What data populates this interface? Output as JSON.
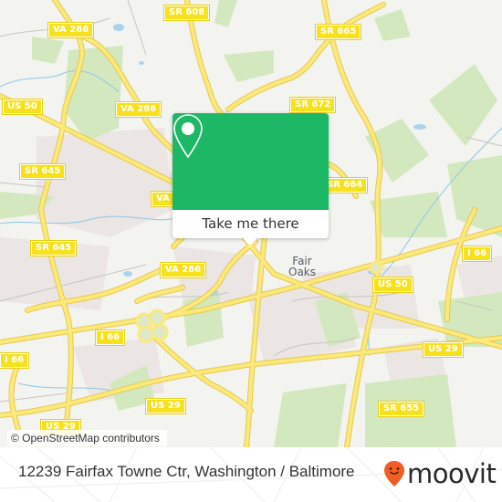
{
  "map": {
    "road_labels": [
      {
        "id": "va286-nw",
        "text": "VA 286"
      },
      {
        "id": "sr608",
        "text": "SR 608"
      },
      {
        "id": "sr665",
        "text": "SR 665"
      },
      {
        "id": "us50-w",
        "text": "US 50"
      },
      {
        "id": "va286-n",
        "text": "VA 286"
      },
      {
        "id": "sr672",
        "text": "SR 672"
      },
      {
        "id": "sr645-n",
        "text": "SR 645"
      },
      {
        "id": "va-partial",
        "text": "VA"
      },
      {
        "id": "sr664",
        "text": "SR 664"
      },
      {
        "id": "sr645-s",
        "text": "SR 645"
      },
      {
        "id": "va286-s",
        "text": "VA 286"
      },
      {
        "id": "i66-e",
        "text": "I 66"
      },
      {
        "id": "us50-e",
        "text": "US 50"
      },
      {
        "id": "i66-c",
        "text": "I 66"
      },
      {
        "id": "i66-w",
        "text": "I 66"
      },
      {
        "id": "us29-e",
        "text": "US 29"
      },
      {
        "id": "us29-c",
        "text": "US 29"
      },
      {
        "id": "sr655",
        "text": "SR 655"
      },
      {
        "id": "us29-w",
        "text": "US 29"
      }
    ],
    "place_label": {
      "line1": "Fair",
      "line2": "Oaks"
    },
    "attribution": "© OpenStreetMap contributors"
  },
  "popup": {
    "icon": "map-pin-icon",
    "button_label": "Take me there",
    "accent_color": "#1db866"
  },
  "footer": {
    "address": "12239 Fairfax Towne Ctr, Washington / Baltimore",
    "brand": "moovit",
    "brand_icon": "moovit-pin-icon",
    "brand_color": "#f25c25"
  }
}
